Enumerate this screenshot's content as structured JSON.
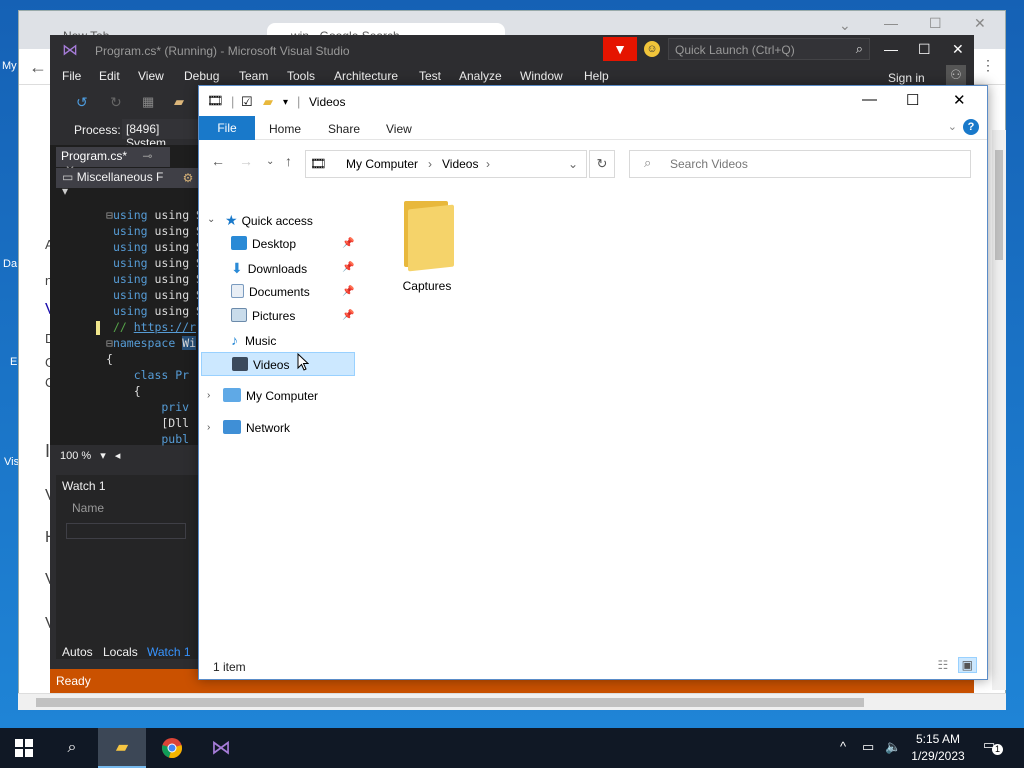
{
  "desktop": {
    "icon_labels": [
      "My",
      "Da",
      "E",
      "Vis"
    ]
  },
  "chrome": {
    "tabs": [
      "New Tab",
      "win - Google Search"
    ],
    "side_text": [
      "A",
      "n",
      "V",
      "D",
      "G",
      "C",
      "I",
      "V",
      "H",
      "V",
      "V"
    ]
  },
  "vs": {
    "title": "Program.cs* (Running) - Microsoft Visual Studio",
    "quick_launch_placeholder": "Quick Launch (Ctrl+Q)",
    "menu": [
      "File",
      "Edit",
      "View",
      "Debug",
      "Team",
      "Tools",
      "Architecture",
      "Test",
      "Analyze",
      "Window",
      "Help"
    ],
    "sign_in": "Sign in",
    "process_label": "Process:",
    "process_value": "[8496] System",
    "doc_tab": "Program.cs*",
    "nav_dropdown": "Miscellaneous F",
    "code_lines": {
      "l1": "using System",
      "l2": "using System",
      "l3": "using System",
      "l4": "using System",
      "l5": "using System",
      "l6": "using System",
      "l7": "using System",
      "l8_comment": "// ",
      "l8_link": "https://r",
      "l9": "namespace ",
      "l9_hl": "Wi",
      "l10": "{",
      "l11": "    class Pr",
      "l12": "    {",
      "l13": "        priv",
      "l14": "",
      "l15": "        [Dll",
      "l16": "        publ"
    },
    "zoom": "100 %",
    "watch_title": "Watch 1",
    "watch_column": "Name",
    "bottom_tabs": [
      "Autos",
      "Locals",
      "Watch 1"
    ],
    "status": "Ready"
  },
  "explorer": {
    "title": "Videos",
    "ribbon_tabs": [
      "File",
      "Home",
      "Share",
      "View"
    ],
    "breadcrumb": [
      "My Computer",
      "Videos"
    ],
    "search_placeholder": "Search Videos",
    "nav": {
      "quick_access": "Quick access",
      "desktop": "Desktop",
      "downloads": "Downloads",
      "documents": "Documents",
      "pictures": "Pictures",
      "music": "Music",
      "videos": "Videos",
      "my_computer": "My Computer",
      "network": "Network"
    },
    "items": [
      {
        "name": "Captures",
        "icon": "folder-icon"
      }
    ],
    "status": "1 item"
  },
  "taskbar": {
    "time": "5:15 AM",
    "date": "1/29/2023",
    "notification_count": "1"
  }
}
